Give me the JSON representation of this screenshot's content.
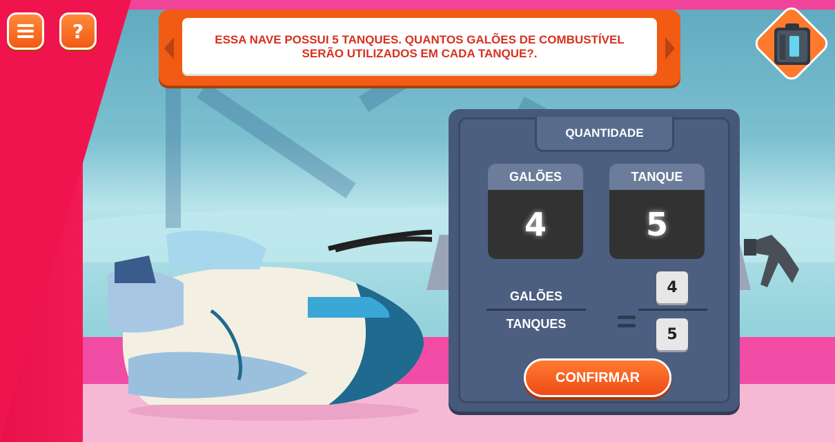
{
  "hud": {
    "menu_icon": "hamburger-menu-icon",
    "help_label": "?",
    "inventory_icon": "fuel-canister-icon"
  },
  "prompt": {
    "line1": "ESSA NAVE POSSUI 5 TANQUES. QUANTOS GALÕES DE COMBUSTÍVEL",
    "line2": "SERÃO UTILIZADOS EM CADA TANQUE?."
  },
  "panel": {
    "title": "QUANTIDADE",
    "gallons": {
      "label": "GALÕES",
      "value": "4"
    },
    "tank": {
      "label": "TANQUE",
      "value": "5"
    },
    "fraction": {
      "numerator_label": "GALÕES",
      "denominator_label": "TANQUES",
      "numerator_value": "4",
      "denominator_value": "5"
    },
    "confirm_label": "CONFIRMAR"
  },
  "colors": {
    "accent": "#f25b14",
    "prompt_text": "#d7301e",
    "panel": "#47597a",
    "wall": "#f0144e",
    "floor": "#f04da6"
  }
}
